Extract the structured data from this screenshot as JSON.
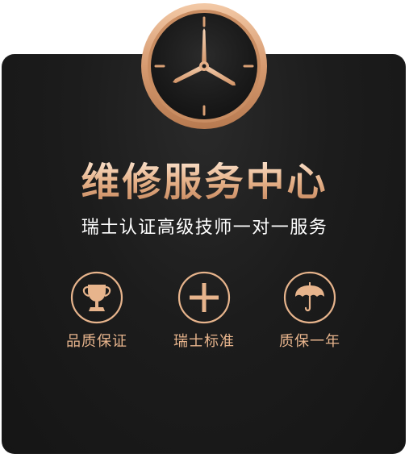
{
  "title": "维修服务中心",
  "subtitle": "瑞士认证高级技师一对一服务",
  "features": [
    {
      "label": "品质保证",
      "icon": "trophy-icon"
    },
    {
      "label": "瑞士标准",
      "icon": "plus-cross-icon"
    },
    {
      "label": "质保一年",
      "icon": "umbrella-icon"
    }
  ],
  "colors": {
    "accent": "#e7b48c",
    "card_background": "#1c1c1c",
    "subtitle_text": "#ffffff"
  }
}
